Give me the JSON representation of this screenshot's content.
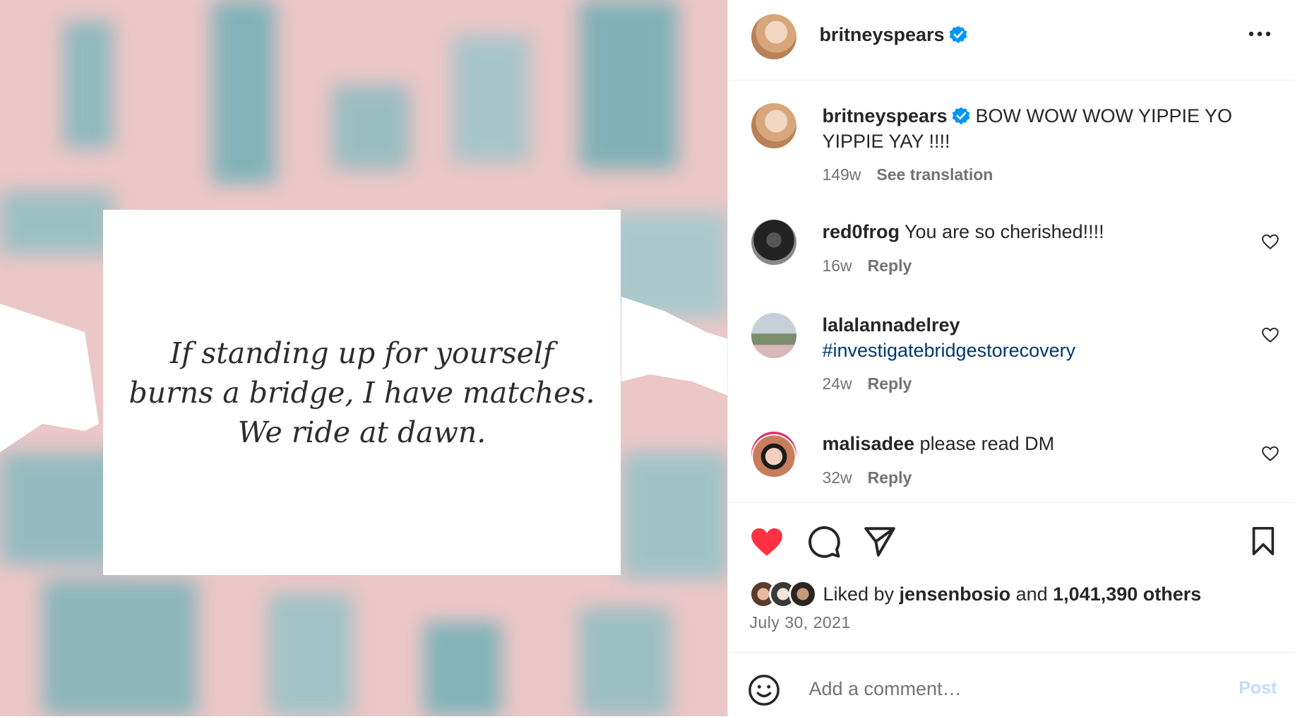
{
  "post": {
    "author": "britneyspears",
    "quote_lines": [
      "If standing up for yourself",
      "burns a bridge, I have matches.",
      "We ride at dawn."
    ]
  },
  "caption": {
    "author": "britneyspears",
    "text": "BOW WOW WOW YIPPIE YO YIPPIE YAY !!!!",
    "age": "149w",
    "see_translation": "See translation"
  },
  "comments": [
    {
      "user": "red0frog",
      "text": "You are so cherished!!!!",
      "age": "16w",
      "reply": "Reply"
    },
    {
      "user": "lalalannadelrey",
      "text": "#investigatebridgestorecovery",
      "age": "24w",
      "reply": "Reply"
    },
    {
      "user": "malisadee",
      "text": "please read DM",
      "age": "32w",
      "reply": "Reply"
    }
  ],
  "likes": {
    "prefix": "Liked by",
    "user": "jensenbosio",
    "and": "and",
    "others": "1,041,390 others"
  },
  "date": "July 30, 2021",
  "add_comment": {
    "placeholder": "Add a comment…",
    "post_label": "Post"
  },
  "colors": {
    "like_red": "#ff3040",
    "verified_blue": "#0095f6",
    "link_blue": "#00376b",
    "post_disabled": "#c1dbfb"
  }
}
